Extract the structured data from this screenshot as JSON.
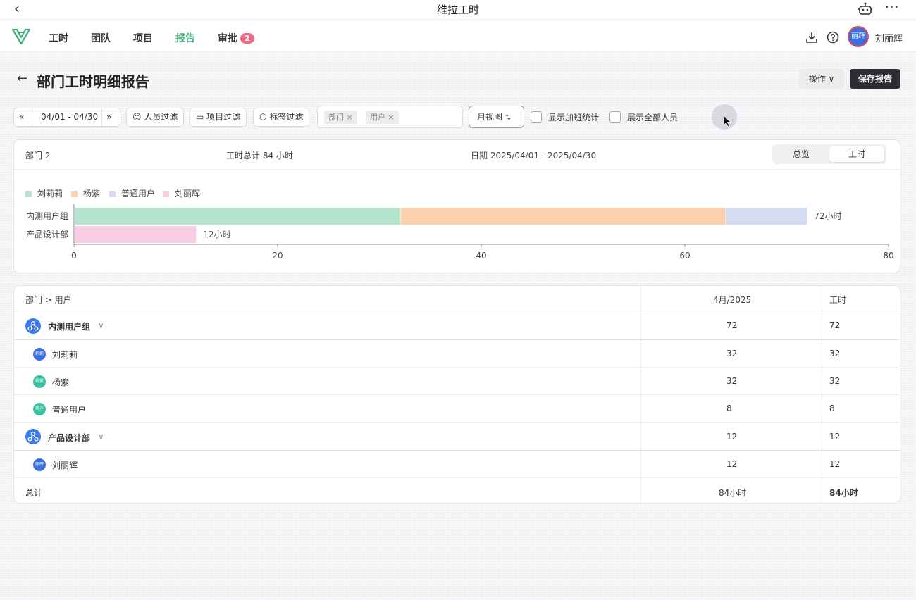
{
  "window": {
    "title": "维拉工时"
  },
  "nav": {
    "items": [
      {
        "label": "工时"
      },
      {
        "label": "团队"
      },
      {
        "label": "项目"
      },
      {
        "label": "报告"
      },
      {
        "label": "审批"
      }
    ],
    "approval_badge": "2",
    "user_name": "刘丽辉",
    "avatar_text": "丽辉",
    "active_color": "#4caf7d"
  },
  "page": {
    "title": "部门工时明细报告",
    "ops_label": "操作",
    "save_label": "保存报告"
  },
  "filters": {
    "date_range": "04/01 - 04/30",
    "person_filter": "人员过滤",
    "project_filter": "项目过滤",
    "tag_filter": "标签过滤",
    "group_tags": [
      "部门",
      "用户"
    ],
    "view": "月视图",
    "show_overtime": "显示加班统计",
    "show_all_people": "展示全部人员"
  },
  "summary": {
    "dept": "部门 2",
    "total": "工时总计 84 小时",
    "date": "日期 2025/04/01 - 2025/04/30",
    "tab_overview": "总览",
    "tab_hours": "工时"
  },
  "chart_data": {
    "type": "bar",
    "orientation": "horizontal",
    "stacked": true,
    "categories": [
      "内测用户组",
      "产品设计部"
    ],
    "series": [
      {
        "name": "刘莉莉",
        "values": [
          32,
          0
        ],
        "color": "#b5e4cf"
      },
      {
        "name": "杨紫",
        "values": [
          32,
          0
        ],
        "color": "#fdd2ae"
      },
      {
        "name": "普通用户",
        "values": [
          8,
          0
        ],
        "color": "#d4dcf1"
      },
      {
        "name": "刘丽辉",
        "values": [
          0,
          12
        ],
        "color": "#f8cce3"
      }
    ],
    "data_labels": [
      "72小时",
      "12小时"
    ],
    "xlim": [
      0,
      80
    ],
    "x_ticks": [
      "0",
      "20",
      "40",
      "60",
      "80"
    ],
    "legend": "top-left"
  },
  "table": {
    "headers": {
      "path": "部门 > 用户",
      "month": "4月/2025",
      "hours": "工时"
    },
    "rows": [
      {
        "name": "内测用户组",
        "month": "72",
        "hours": "72",
        "group": true
      },
      {
        "name": "刘莉莉",
        "month": "32",
        "hours": "32",
        "avatar": "莉莉",
        "color": "#3a6fe0"
      },
      {
        "name": "杨紫",
        "month": "32",
        "hours": "32",
        "avatar": "杨紫",
        "color": "#36c2a0"
      },
      {
        "name": "普通用户",
        "month": "8",
        "hours": "8",
        "avatar": "用户",
        "color": "#36c2a0"
      },
      {
        "name": "产品设计部",
        "month": "12",
        "hours": "12",
        "group": true
      },
      {
        "name": "刘丽辉",
        "month": "12",
        "hours": "12",
        "avatar": "丽辉",
        "color": "#3a6fe0"
      }
    ],
    "footer": {
      "label": "总计",
      "month": "84小时",
      "hours": "84小时"
    }
  }
}
